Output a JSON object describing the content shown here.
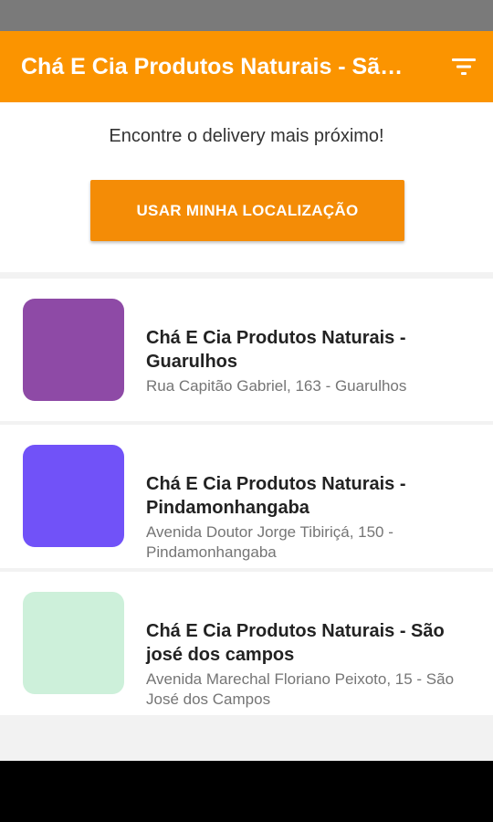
{
  "app_bar": {
    "title": "Chá E Cia Produtos Naturais - São José dos Campos",
    "filter_icon": "filter-icon"
  },
  "locate": {
    "prompt": "Encontre o delivery mais próximo!",
    "button_label": "USAR MINHA LOCALIZAÇÃO"
  },
  "stores": [
    {
      "name": "Chá E Cia Produtos Naturais - Guarulhos",
      "address": "Rua Capitão Gabriel, 163 - Guarulhos",
      "color": "#8e4aa6"
    },
    {
      "name": "Chá E Cia Produtos Naturais - Pindamonhangaba",
      "address": "Avenida Doutor Jorge Tibiriçá, 150 - Pindamonhangaba",
      "color": "#7152f8"
    },
    {
      "name": "Chá E Cia Produtos Naturais - São josé dos campos",
      "address": "Avenida Marechal Floriano Peixoto, 15 - São José dos Campos",
      "color": "#cdf0da"
    }
  ],
  "colors": {
    "primary": "#fb9400",
    "button": "#f48c06"
  }
}
